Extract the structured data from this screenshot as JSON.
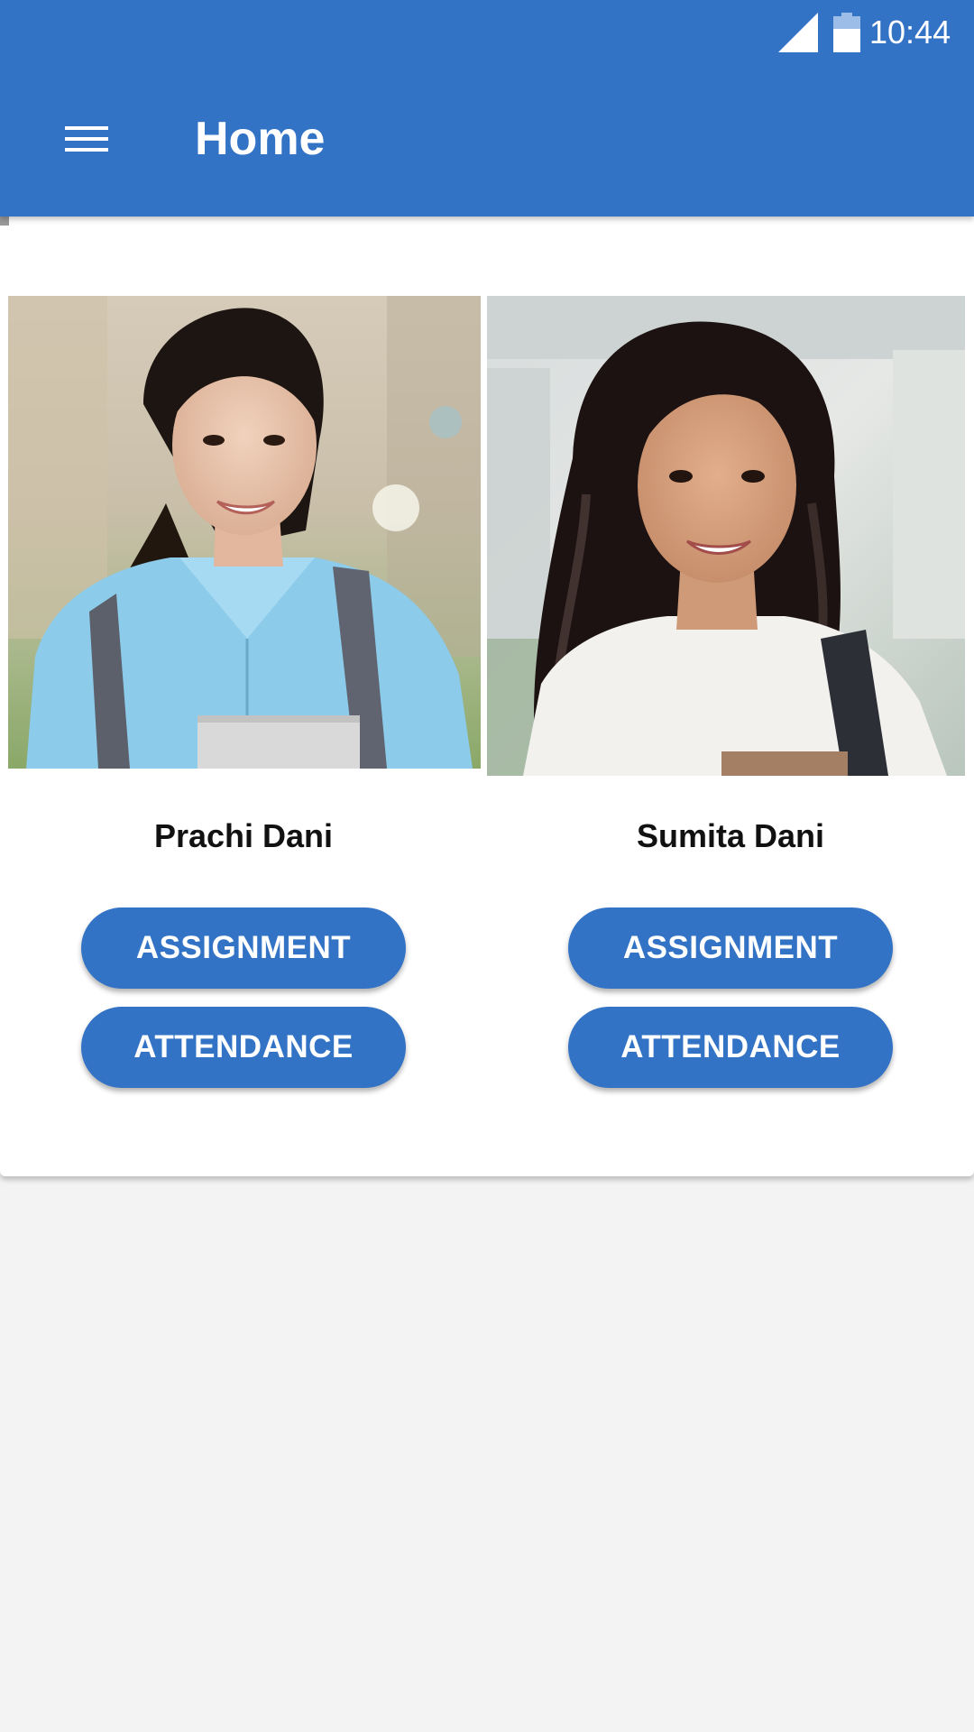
{
  "status_bar": {
    "time": "10:44",
    "signal_icon": "signal-icon",
    "battery_icon": "battery-icon"
  },
  "app_bar": {
    "title": "Home",
    "menu_icon": "menu-icon",
    "color": "#3373c6"
  },
  "students": [
    {
      "name": "Prachi Dani",
      "assignment_label": "ASSIGNMENT",
      "attendance_label": "ATTENDANCE"
    },
    {
      "name": "Sumita Dani",
      "assignment_label": "ASSIGNMENT",
      "attendance_label": "ATTENDANCE"
    }
  ],
  "colors": {
    "accent": "#3373c6",
    "background": "#f3f3f3",
    "card": "#ffffff"
  }
}
